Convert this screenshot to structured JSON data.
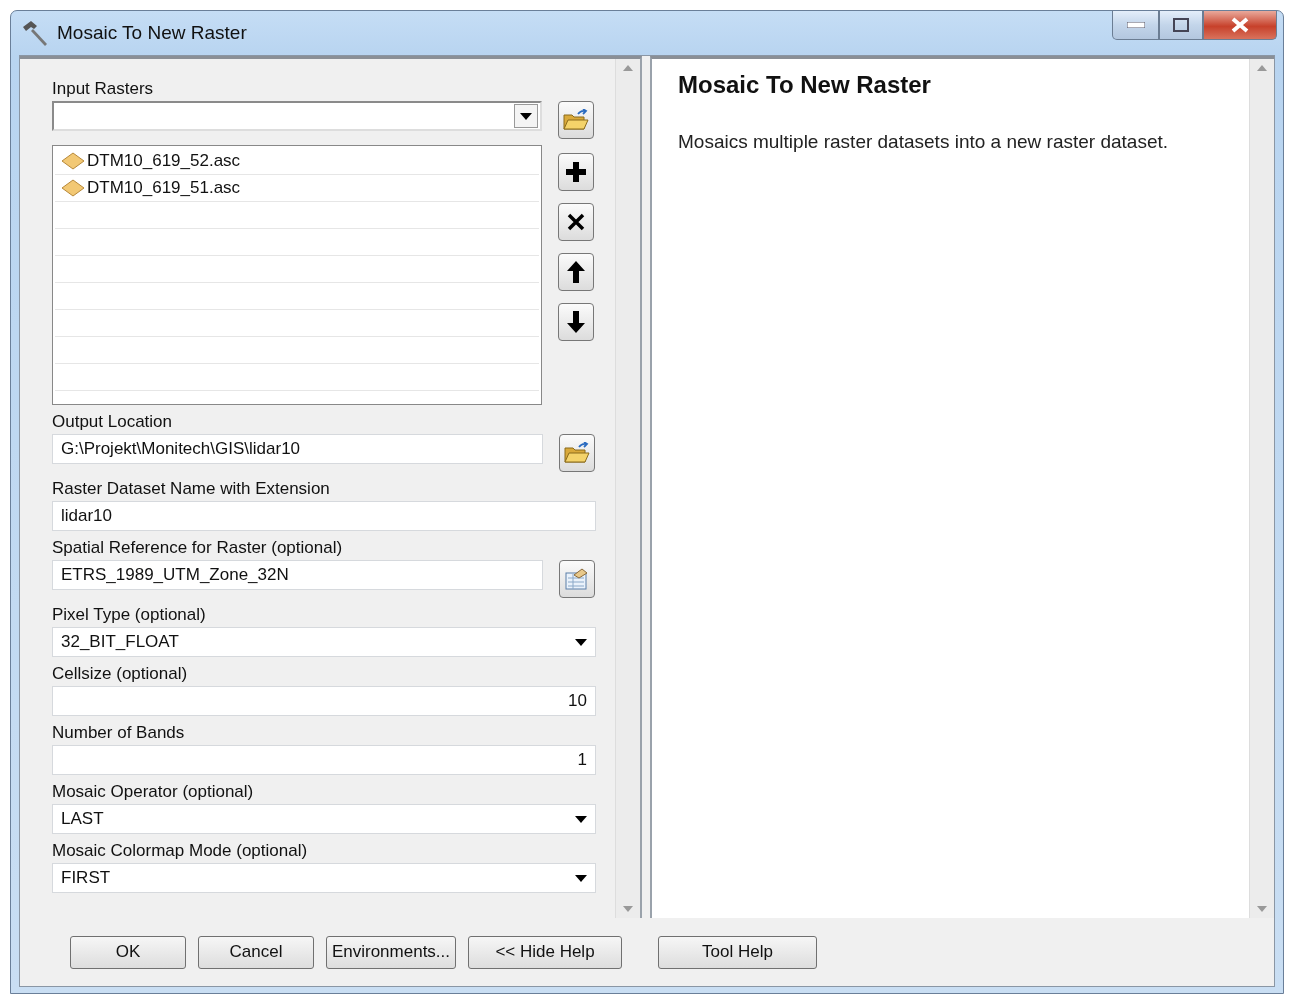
{
  "window": {
    "title": "Mosaic To New Raster"
  },
  "parameters": [
    {
      "kind": "raster_list",
      "label": "Input Rasters",
      "items": [
        "DTM10_619_52.asc",
        "DTM10_619_51.asc"
      ]
    },
    {
      "kind": "browse",
      "label": "Output Location",
      "value": "G:\\Projekt\\Monitech\\GIS\\lidar10"
    },
    {
      "kind": "text",
      "label": "Raster Dataset Name with Extension",
      "value": "lidar10"
    },
    {
      "kind": "properties",
      "label": "Spatial Reference for Raster (optional)",
      "value": "ETRS_1989_UTM_Zone_32N"
    },
    {
      "kind": "dropdown",
      "label": "Pixel Type (optional)",
      "value": "32_BIT_FLOAT"
    },
    {
      "kind": "number",
      "label": "Cellsize (optional)",
      "value": "10"
    },
    {
      "kind": "number",
      "label": "Number of Bands",
      "value": "1"
    },
    {
      "kind": "dropdown",
      "label": "Mosaic Operator (optional)",
      "value": "LAST"
    },
    {
      "kind": "dropdown",
      "label": "Mosaic Colormap Mode (optional)",
      "value": "FIRST"
    }
  ],
  "help": {
    "title": "Mosaic To New Raster",
    "text": "Mosaics multiple raster datasets into a new raster dataset."
  },
  "buttons": [
    "OK",
    "Cancel",
    "Environments...",
    "<< Hide Help",
    "Tool Help"
  ]
}
